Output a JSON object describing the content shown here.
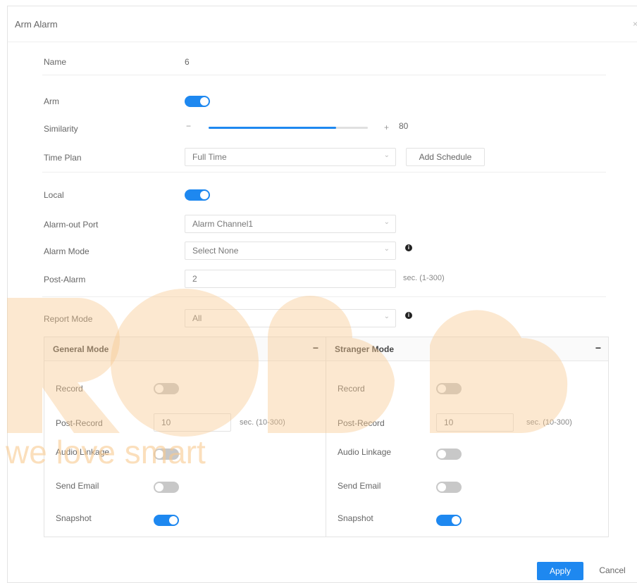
{
  "dialog": {
    "title": "Arm Alarm",
    "close_symbol": "×"
  },
  "form": {
    "name": {
      "label": "Name",
      "value": "6"
    },
    "arm": {
      "label": "Arm",
      "on": true
    },
    "similarity": {
      "label": "Similarity",
      "minus": "−",
      "plus": "+",
      "value": "80",
      "fill_percent": 80
    },
    "time_plan": {
      "label": "Time Plan",
      "value": "Full Time",
      "add_schedule": "Add Schedule"
    },
    "local": {
      "label": "Local",
      "on": true
    },
    "alarm_out_port": {
      "label": "Alarm-out Port",
      "value": "Alarm Channel1"
    },
    "alarm_mode": {
      "label": "Alarm Mode",
      "value": "Select None"
    },
    "post_alarm": {
      "label": "Post-Alarm",
      "value": "2",
      "unit": "sec. (1-300)"
    },
    "report_mode": {
      "label": "Report Mode",
      "value": "All"
    }
  },
  "panels": {
    "general": {
      "title": "General Mode",
      "collapse_symbol": "−",
      "record": {
        "label": "Record",
        "on": false
      },
      "post_record": {
        "label": "Post-Record",
        "value": "10",
        "unit": "sec. (10-300)"
      },
      "audio_linkage": {
        "label": "Audio Linkage",
        "on": false
      },
      "send_email": {
        "label": "Send Email",
        "on": false
      },
      "snapshot": {
        "label": "Snapshot",
        "on": true
      }
    },
    "stranger": {
      "title": "Stranger Mode",
      "collapse_symbol": "−",
      "record": {
        "label": "Record",
        "on": false
      },
      "post_record": {
        "label": "Post-Record",
        "value": "10",
        "unit": "sec. (10-300)"
      },
      "audio_linkage": {
        "label": "Audio Linkage",
        "on": false
      },
      "send_email": {
        "label": "Send Email",
        "on": false
      },
      "snapshot": {
        "label": "Snapshot",
        "on": true
      }
    }
  },
  "footer": {
    "apply": "Apply",
    "cancel": "Cancel"
  },
  "icons": {
    "info": "info-icon",
    "chevron": "chevron-down-icon"
  },
  "colors": {
    "accent": "#1e88f0",
    "watermark": "#f9c98f"
  },
  "watermark": {
    "text": "we love smart"
  }
}
